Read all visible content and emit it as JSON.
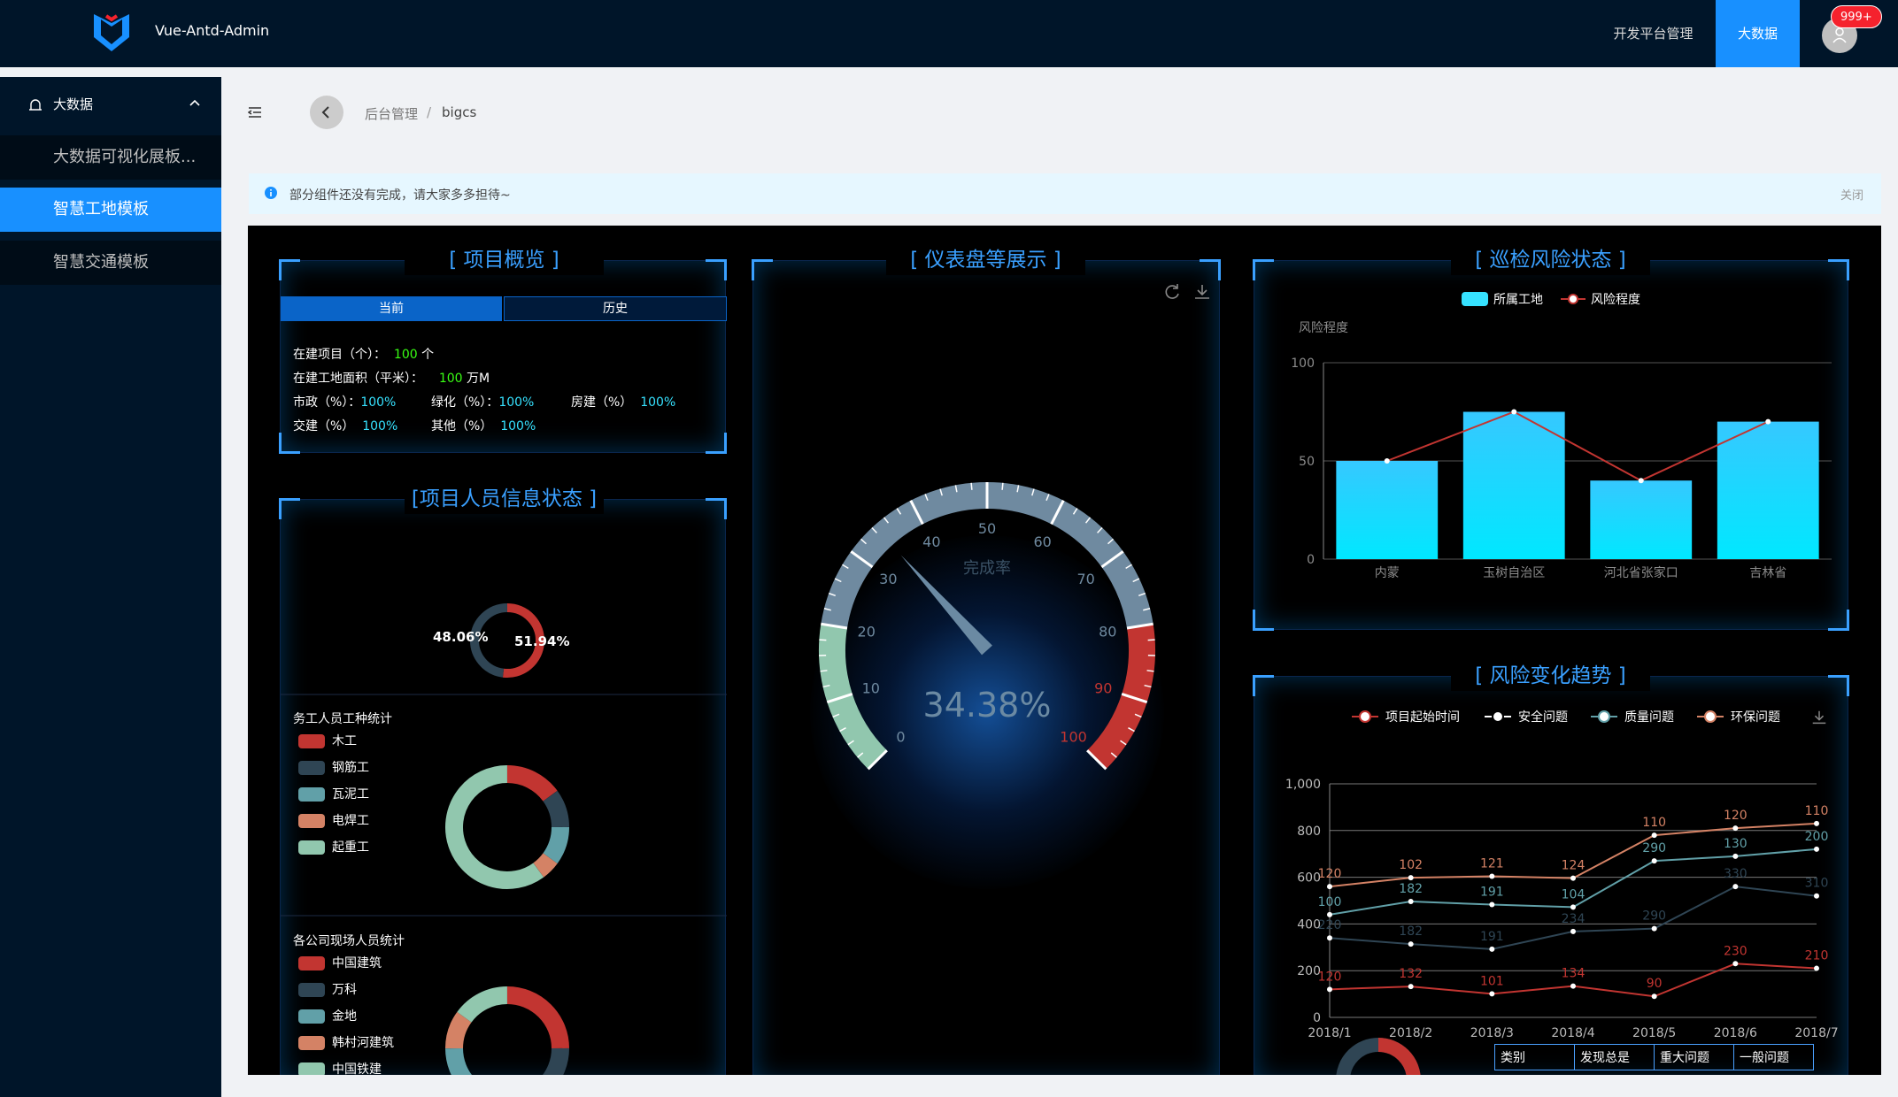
{
  "app": {
    "title": "Vue-Antd-Admin",
    "nav": [
      "开发平台管理",
      "大数据"
    ],
    "badge": "999+"
  },
  "sidebar": {
    "group": "大数据",
    "items": [
      "大数据可视化展板...",
      "智慧工地模板",
      "智慧交通模板"
    ]
  },
  "breadcrumb": [
    "后台管理",
    "bigcs"
  ],
  "alert": {
    "text": "部分组件还没有完成，请大家多多担待~",
    "close": "关闭"
  },
  "panels": {
    "overview": "项目概览",
    "gauge": "仪表盘等展示",
    "patrol": "巡检风险状态",
    "people": "项目人员信息状态",
    "trend": "风险变化趋势"
  },
  "overview": {
    "tabs": [
      "当前",
      "历史"
    ],
    "line1": "在建项目（个）：",
    "v1": "100",
    "u1": "个",
    "line2": "在建工地面积（平米）：",
    "v2": "100",
    "u2": "万M",
    "r3": [
      {
        "k": "市政（%）：",
        "v": "100%"
      },
      {
        "k": "绿化（%）：",
        "v": "100%"
      },
      {
        "k": "房建（%）",
        "v": "100%"
      }
    ],
    "r4": [
      {
        "k": "交建（%）",
        "v": "100%"
      },
      {
        "k": "其他（%）",
        "v": "100%"
      }
    ]
  },
  "people": {
    "p1": "48.06%",
    "p2": "51.94%",
    "t1": "务工人员工种统计",
    "l1": [
      "木工",
      "钢筋工",
      "瓦泥工",
      "电焊工",
      "起重工"
    ],
    "t2": "各公司现场人员统计",
    "l2": [
      "中国建筑",
      "万科",
      "金地",
      "韩村河建筑",
      "中国铁建"
    ]
  },
  "colors": {
    "red": "#c23531",
    "dark": "#2f4554",
    "teal": "#61a0a8",
    "orange": "#d48265",
    "green": "#91c7ae",
    "cyan": "#36e2ff",
    "blue": "#3aa0ff"
  },
  "chart_data": [
    {
      "type": "gauge",
      "title": "完成率",
      "value": 34.38,
      "label": "34.38%",
      "ticks": [
        "0",
        "10",
        "20",
        "30",
        "40",
        "50",
        "60",
        "70",
        "80",
        "90",
        "100"
      ],
      "range": [
        0,
        100
      ]
    },
    {
      "type": "bar",
      "legend": [
        "所属工地",
        "风险程度"
      ],
      "ylabel": "风险程度",
      "categories": [
        "内蒙",
        "玉树自治区",
        "河北省张家口",
        "吉林省"
      ],
      "yticks": [
        "0",
        "50",
        "100"
      ],
      "ylim": [
        0,
        100
      ],
      "series": [
        {
          "name": "所属工地",
          "type": "bar",
          "values": [
            50,
            75,
            40,
            70
          ]
        },
        {
          "name": "风险程度",
          "type": "line",
          "values": [
            50,
            75,
            40,
            70
          ]
        }
      ]
    },
    {
      "type": "line",
      "legend": [
        "项目起始时间",
        "安全问题",
        "质量问题",
        "环保问题"
      ],
      "x": [
        "2018/1",
        "2018/2",
        "2018/3",
        "2018/4",
        "2018/5",
        "2018/6",
        "2018/7"
      ],
      "yticks": [
        "0",
        "200",
        "400",
        "600",
        "800",
        "1,000"
      ],
      "ylim": [
        0,
        1000
      ],
      "series": [
        {
          "name": "项目起始时间",
          "values": [
            120,
            132,
            101,
            134,
            90,
            230,
            210
          ]
        },
        {
          "name": "安全问题",
          "values": [
            220,
            182,
            191,
            234,
            290,
            330,
            310
          ]
        },
        {
          "name": "质量问题",
          "values": [
            100,
            182,
            191,
            104,
            290,
            130,
            200
          ]
        },
        {
          "name": "环保问题",
          "values": [
            120,
            102,
            121,
            124,
            110,
            120,
            110
          ]
        }
      ]
    }
  ],
  "table": {
    "headers": [
      "类别",
      "发现总是",
      "重大问题",
      "一般问题"
    ]
  }
}
